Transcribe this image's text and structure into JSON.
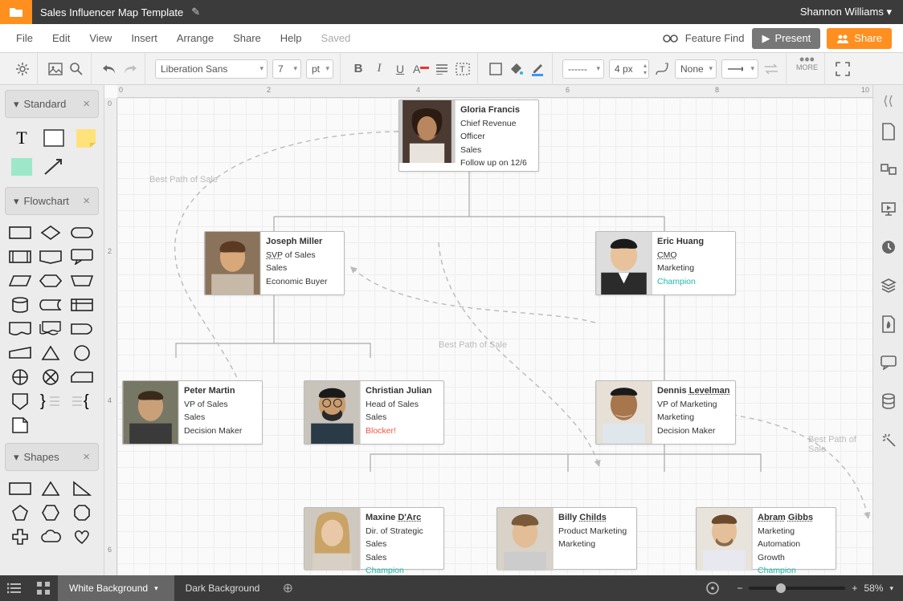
{
  "titlebar": {
    "title": "Sales Influencer Map Template",
    "user": "Shannon Williams"
  },
  "menu": {
    "file": "File",
    "edit": "Edit",
    "view": "View",
    "insert": "Insert",
    "arrange": "Arrange",
    "share": "Share",
    "help": "Help",
    "saved": "Saved",
    "feature_find": "Feature Find",
    "present": "Present",
    "share_btn": "Share"
  },
  "toolbar": {
    "font": "Liberation Sans",
    "size": "7",
    "unit": "pt",
    "line_style": "------",
    "line_px": "4 px",
    "fill": "None",
    "more": "MORE"
  },
  "shape_sections": {
    "standard": "Standard",
    "flowchart": "Flowchart",
    "shapes": "Shapes"
  },
  "ruler_h": [
    "0",
    "2",
    "4",
    "6",
    "8",
    "10"
  ],
  "ruler_v": [
    "0",
    "2",
    "4",
    "6"
  ],
  "hints": {
    "a": "Best Path of Sale",
    "b": "Best Path of Sale",
    "c": "Best Path of Sale"
  },
  "cards": {
    "gloria": {
      "name": "Gloria Francis",
      "title": "Chief Revenue Officer",
      "dept": "Sales",
      "note": "Follow up on 12/6",
      "note_class": ""
    },
    "joseph": {
      "name": "Joseph Miller",
      "title": "<span class='u'>SVP</span> of Sales",
      "dept": "Sales",
      "note": "Economic Buyer",
      "note_class": ""
    },
    "eric": {
      "name": "Eric Huang",
      "title": "<span class='u'>CMO</span>",
      "dept": "Marketing",
      "note": "Champion",
      "note_class": "teal"
    },
    "peter": {
      "name": "Peter Martin",
      "title": "VP of Sales",
      "dept": "Sales",
      "note": "Decision Maker",
      "note_class": ""
    },
    "christian": {
      "name": "Christian Julian",
      "title": "Head of Sales",
      "dept": "Sales",
      "note": "Blocker!",
      "note_class": "red"
    },
    "dennis": {
      "name": "Dennis <span class='u'>Levelman</span>",
      "title": "VP of Marketing",
      "dept": "Marketing",
      "note": "Decision Maker",
      "note_class": ""
    },
    "maxine": {
      "name": "Maxine <span class='u'>D'Arc</span>",
      "title": "Dir. of Strategic Sales",
      "dept": "Sales",
      "note": "Champion",
      "note_class": "teal"
    },
    "billy": {
      "name": "Billy <span class='u'>Childs</span>",
      "title": "Product Marketing",
      "dept": "Marketing",
      "note": "",
      "note_class": ""
    },
    "abram": {
      "name": "<span class='u'>Abram</span> <span class='u'>Gibbs</span>",
      "title": "Marketing Automation",
      "dept": "Growth",
      "note": "Champion",
      "note_class": "teal"
    }
  },
  "bottom": {
    "tab1": "White Background",
    "tab2": "Dark Background",
    "zoom": "58%"
  }
}
